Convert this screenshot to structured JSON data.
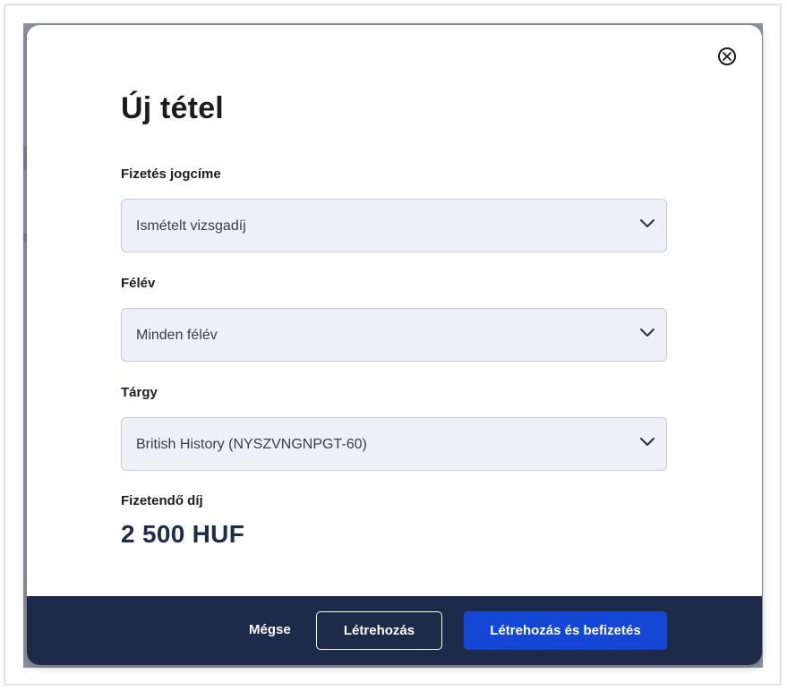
{
  "modal": {
    "title": "Új tétel",
    "fields": [
      {
        "label": "Fizetés jogcíme",
        "value": "Ismételt vizsgadíj"
      },
      {
        "label": "Félév",
        "value": "Minden félév"
      },
      {
        "label": "Tárgy",
        "value": "British History (NYSZVNGNPGT-60)"
      }
    ],
    "fee": {
      "label": "Fizetendő díj",
      "value": "2 500 HUF"
    },
    "footer": {
      "cancel_label": "Mégse",
      "create_label": "Létrehozás",
      "create_pay_label": "Létrehozás és befizetés"
    }
  },
  "icons": {
    "close": "close-circle-icon",
    "dropdown": "chevron-down-icon"
  },
  "colors": {
    "footer_bg": "#1e2a4a",
    "primary_button": "#1447d6",
    "select_bg": "#eef0f8",
    "fee_text": "#1f2d4d"
  }
}
